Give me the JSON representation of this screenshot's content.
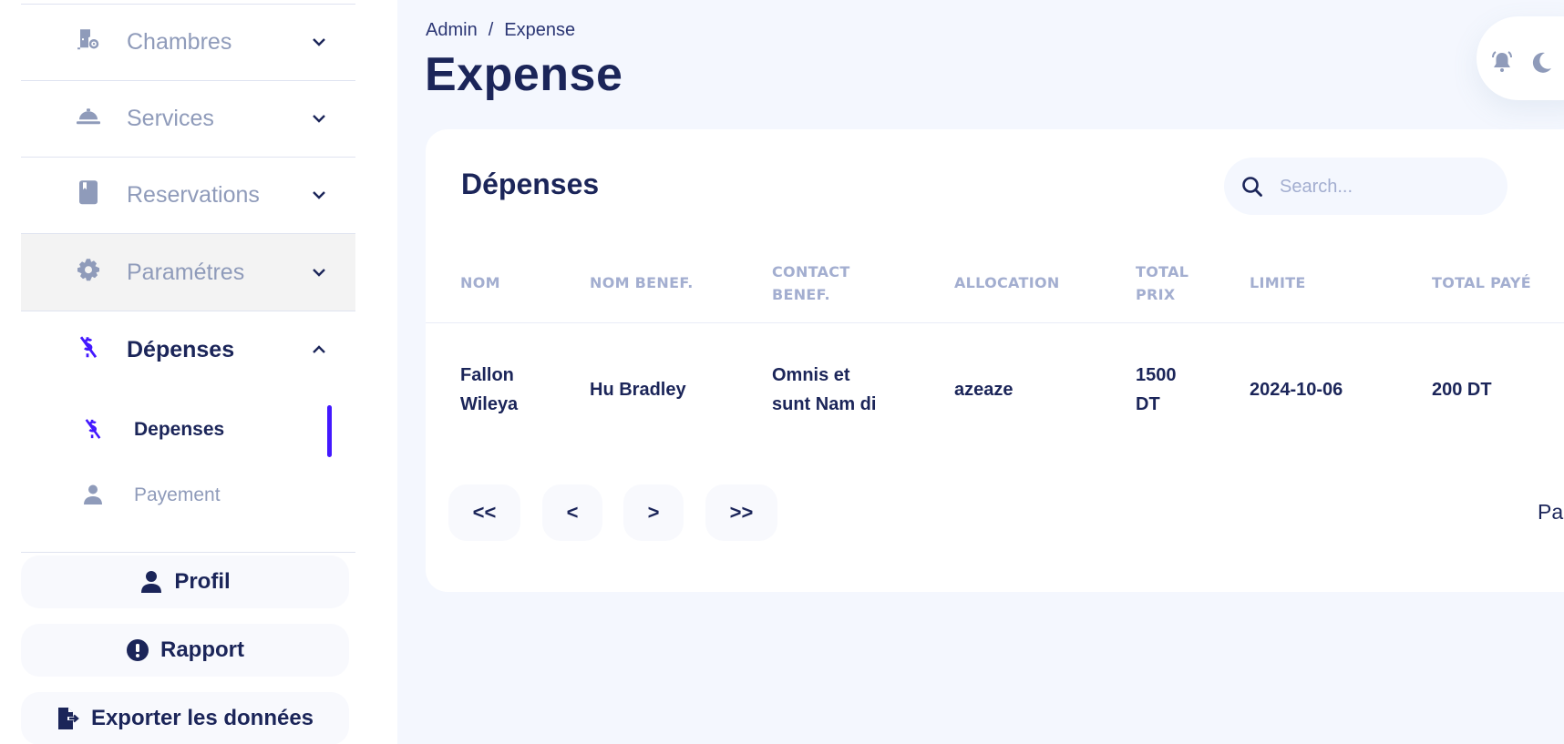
{
  "sidebar": {
    "items": [
      {
        "label": "Chambres",
        "icon": "door-gear-icon",
        "expanded": false
      },
      {
        "label": "Services",
        "icon": "concierge-bell-icon",
        "expanded": false
      },
      {
        "label": "Reservations",
        "icon": "book-icon",
        "expanded": false
      },
      {
        "label": "Paramétres",
        "icon": "gear-icon",
        "expanded": false
      },
      {
        "label": "Dépenses",
        "icon": "dollar-slash-icon",
        "expanded": true
      }
    ],
    "sub_items": [
      {
        "label": "Depenses",
        "icon": "dollar-slash-icon",
        "active": true
      },
      {
        "label": "Payement",
        "icon": "user-icon",
        "active": false
      }
    ],
    "buttons": {
      "profil": "Profil",
      "rapport": "Rapport",
      "exporter": "Exporter les données"
    }
  },
  "header": {
    "breadcrumb": [
      "Admin",
      "Expense"
    ],
    "breadcrumb_separator": "/",
    "title": "Expense"
  },
  "topbar": {
    "icons": [
      "bell-icon",
      "moon-icon"
    ]
  },
  "card": {
    "title": "Dépenses",
    "search": {
      "placeholder": "Search...",
      "value": ""
    },
    "columns": [
      {
        "line1": "NOM",
        "line2": ""
      },
      {
        "line1": "NOM BENEF.",
        "line2": ""
      },
      {
        "line1": "CONTACT",
        "line2": "BENEF."
      },
      {
        "line1": "ALLOCATION",
        "line2": ""
      },
      {
        "line1": "TOTAL",
        "line2": "PRIX"
      },
      {
        "line1": "LIMITE",
        "line2": ""
      },
      {
        "line1": "TOTAL PAYÉ",
        "line2": ""
      }
    ],
    "rows": [
      {
        "nom": [
          "Fallon",
          "Wileya"
        ],
        "nom_benef": "Hu Bradley",
        "contact_benef": [
          "Omnis et",
          "sunt Nam di"
        ],
        "allocation": "azeaze",
        "total_prix": [
          "1500",
          "DT"
        ],
        "limite": "2024-10-06",
        "total_paye": "200 DT"
      }
    ],
    "pagination": {
      "first": "<<",
      "prev": "<",
      "next": ">",
      "last": ">>",
      "page_info": "Pag"
    }
  },
  "colors": {
    "accent": "#4318ff",
    "text_primary": "#1b2559",
    "text_muted": "#8f9bba",
    "header_muted": "#a3aed0",
    "background": "#f4f7fe"
  }
}
